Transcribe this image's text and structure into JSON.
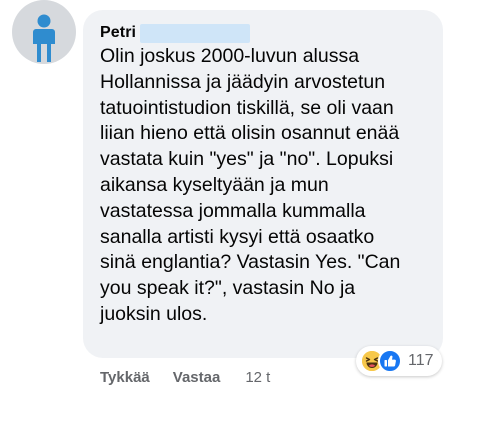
{
  "comment": {
    "author": "Petri",
    "text": "Olin joskus 2000-luvun alussa\nHollannissa ja jäädyin arvostetun\ntatuointistudion tiskillä, se oli vaan\nliian hieno että olisin osannut enää\nvastata kuin \"yes\" ja \"no\". Lopuksi\naikansa kyseltyään ja mun\nvastatessa jommalla kummalla\nsanalla artisti kysyi että osaatko\nsinä englantia? Vastasin Yes. \"Can\nyou speak it?\", vastasin No ja\njuoksin ulos.",
    "reactions": {
      "icons": [
        "haha-emoji-icon",
        "like-thumb-icon"
      ],
      "count": "117"
    }
  },
  "actions": {
    "like_label": "Tykkää",
    "reply_label": "Vastaa",
    "timestamp": "12 t"
  },
  "colors": {
    "bubble_bg": "#f0f2f5",
    "avatar_bg": "#d6d9dd",
    "avatar_figure": "#2f8ccf",
    "name_redaction": "#cfe5f8",
    "text": "#050505",
    "secondary_text": "#65676b",
    "like_blue": "#1877f2",
    "haha_yellow": "#f7c84b"
  }
}
